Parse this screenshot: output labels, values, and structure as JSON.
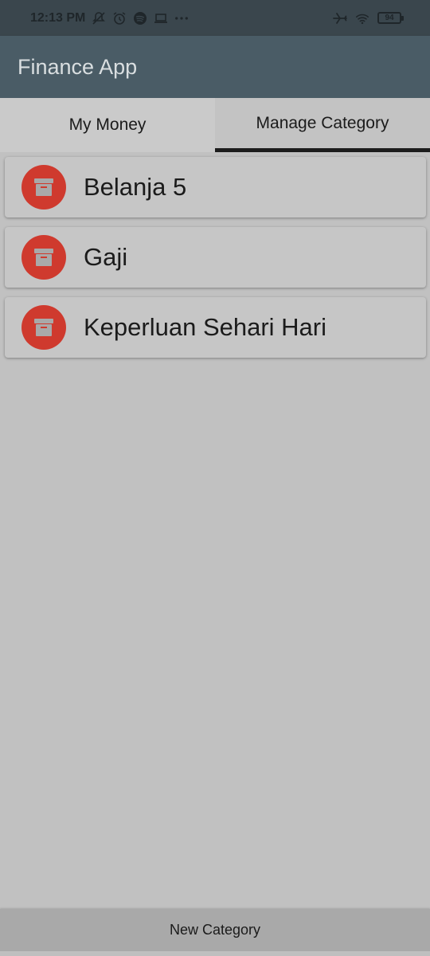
{
  "status_bar": {
    "time": "12:13 PM",
    "left_icons": [
      "notifications-off-icon",
      "alarm-icon",
      "spotify-icon",
      "laptop-icon",
      "more-icon"
    ],
    "right_icons": [
      "airplane-mode-icon",
      "wifi-icon"
    ],
    "battery_level": "94"
  },
  "app_bar": {
    "title": "Finance App"
  },
  "tabs": [
    {
      "label": "My Money",
      "active": false
    },
    {
      "label": "Manage Category",
      "active": true
    }
  ],
  "categories": [
    {
      "label": "Belanja 5",
      "icon": "archive-box-icon"
    },
    {
      "label": "Gaji",
      "icon": "archive-box-icon"
    },
    {
      "label": "Keperluan Sehari Hari",
      "icon": "archive-box-icon"
    }
  ],
  "bottom_button": {
    "label": "New Category"
  },
  "colors": {
    "status_bar_bg": "#3a464d",
    "app_bar_bg": "#4a5c66",
    "avatar_bg": "#cf3a2e",
    "background": "#c1c1c1",
    "bottom_button_bg": "#a9a9a9"
  }
}
